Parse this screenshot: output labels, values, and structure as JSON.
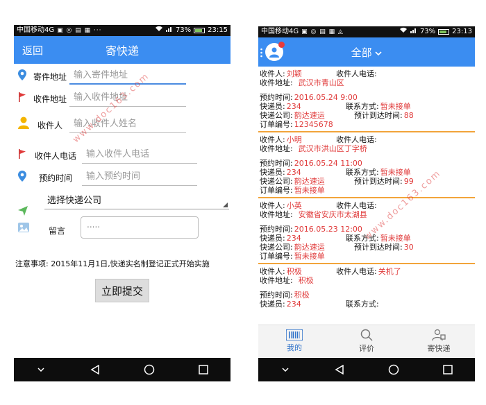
{
  "left": {
    "status": {
      "carrier": "中国移动4G",
      "battery": "73%",
      "time": "23:15"
    },
    "header": {
      "back": "返回",
      "title": "寄快递"
    },
    "form": {
      "sender_address": {
        "label": "寄件地址",
        "placeholder": "输入寄件地址"
      },
      "receiver_address": {
        "label": "收件地址",
        "placeholder": "输入收件地址"
      },
      "receiver_name": {
        "label": "收件人",
        "placeholder": "输入收件人姓名"
      },
      "receiver_phone": {
        "label": "收件人电话",
        "placeholder": "输入收件人电话"
      },
      "appointment_time": {
        "label": "预约时间",
        "placeholder": "输入预约时间"
      },
      "courier_select": "选择快递公司",
      "message": {
        "label": "留言",
        "value": "....."
      }
    },
    "notice": "注意事项:   2015年11月1日,快递实名制登记正式开始实施",
    "submit": "立即提交",
    "watermark": "www.doc163.com"
  },
  "right": {
    "status": {
      "carrier": "中国移动4G",
      "battery": "73%",
      "time": "23:13"
    },
    "header": {
      "title": "全部"
    },
    "labels": {
      "receiver": "收件人:",
      "receiver_phone": "收件人电话:",
      "receiver_address": "收件地址:",
      "appointment": "预约时间:",
      "courier": "快递员:",
      "contact": "联系方式:",
      "company": "快递公司:",
      "eta": "预计到达时间:",
      "order_no": "订单编号:"
    },
    "orders": [
      {
        "receiver": "刘颖",
        "phone": "",
        "address": "武汉市青山区",
        "time": "2016.05.24 9:00",
        "courier": "234",
        "contact": "暂未接单",
        "company": "韵达速运",
        "eta": "88",
        "order_no": "12345678"
      },
      {
        "receiver": "小明",
        "phone": "",
        "address": "武汉市洪山区丁字桥",
        "time": "2016.05.24 11:00",
        "courier": "234",
        "contact": "暂未接单",
        "company": "韵达速运",
        "eta": "99",
        "order_no": "暂未接单"
      },
      {
        "receiver": "小英",
        "phone": "",
        "address": "安徽省安庆市太湖县",
        "time": "2016.05.23 12:00",
        "courier": "234",
        "contact": "暂未接单",
        "company": "韵达速运",
        "eta": "30",
        "order_no": "暂未接单"
      },
      {
        "receiver": "积极",
        "phone": "关机了",
        "address": "积极",
        "time": "积极",
        "courier": "234",
        "contact": "",
        "company": "",
        "eta": "",
        "order_no": ""
      }
    ],
    "tabs": {
      "mine": "我的",
      "review": "评价",
      "send": "寄快递"
    },
    "watermark": "www.doc163.com"
  }
}
